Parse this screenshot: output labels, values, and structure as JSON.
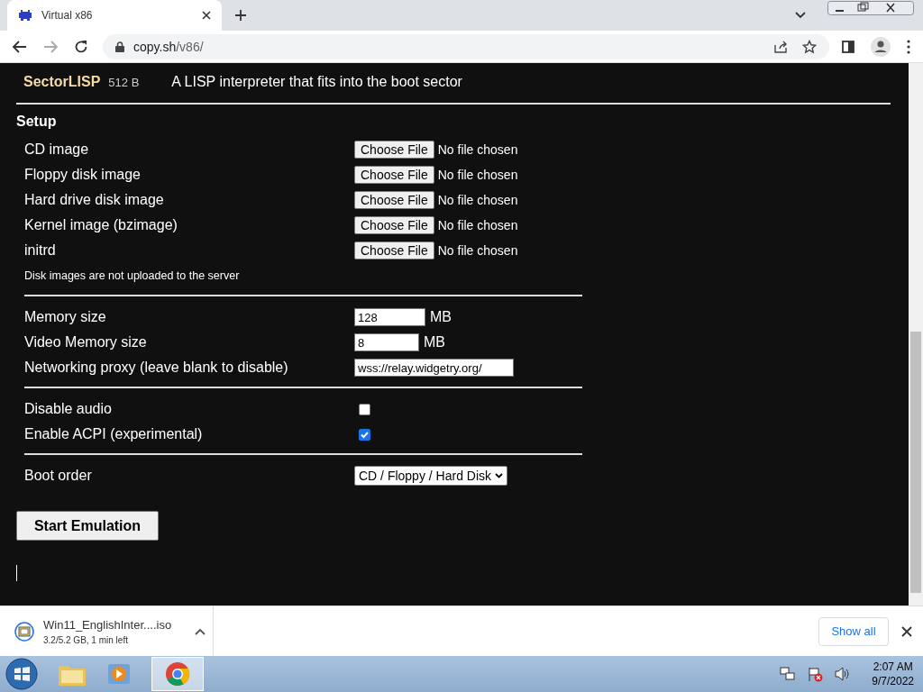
{
  "browser": {
    "tab_title": "Virtual x86",
    "url_host": "copy.sh",
    "url_path": "/v86/"
  },
  "program": {
    "name": "SectorLISP",
    "size": "512 B",
    "description": "A LISP interpreter that fits into the boot sector"
  },
  "setup": {
    "heading": "Setup",
    "files": [
      {
        "label": "CD image",
        "button": "Choose File",
        "status": "No file chosen"
      },
      {
        "label": "Floppy disk image",
        "button": "Choose File",
        "status": "No file chosen"
      },
      {
        "label": "Hard drive disk image",
        "button": "Choose File",
        "status": "No file chosen"
      },
      {
        "label": "Kernel image (bzimage)",
        "button": "Choose File",
        "status": "No file chosen"
      },
      {
        "label": "initrd",
        "button": "Choose File",
        "status": "No file chosen"
      }
    ],
    "note": "Disk images are not uploaded to the server",
    "fields": [
      {
        "label": "Memory size",
        "value": "128",
        "unit": "MB"
      },
      {
        "label": "Video Memory size",
        "value": "8",
        "unit": "MB"
      },
      {
        "label": "Networking proxy (leave blank to disable)",
        "value": "wss://relay.widgetry.org/"
      }
    ],
    "options": [
      {
        "label": "Disable audio",
        "checked": false
      },
      {
        "label": "Enable ACPI (experimental)",
        "checked": true
      }
    ],
    "boot_order": {
      "label": "Boot order",
      "value": "CD / Floppy / Hard Disk"
    },
    "start_button": "Start Emulation"
  },
  "download": {
    "file": "Win11_EnglishInter....iso",
    "progress": "3.2/5.2 GB, 1 min left",
    "show_all": "Show all"
  },
  "taskbar": {
    "time": "2:07 AM",
    "date": "9/7/2022"
  }
}
